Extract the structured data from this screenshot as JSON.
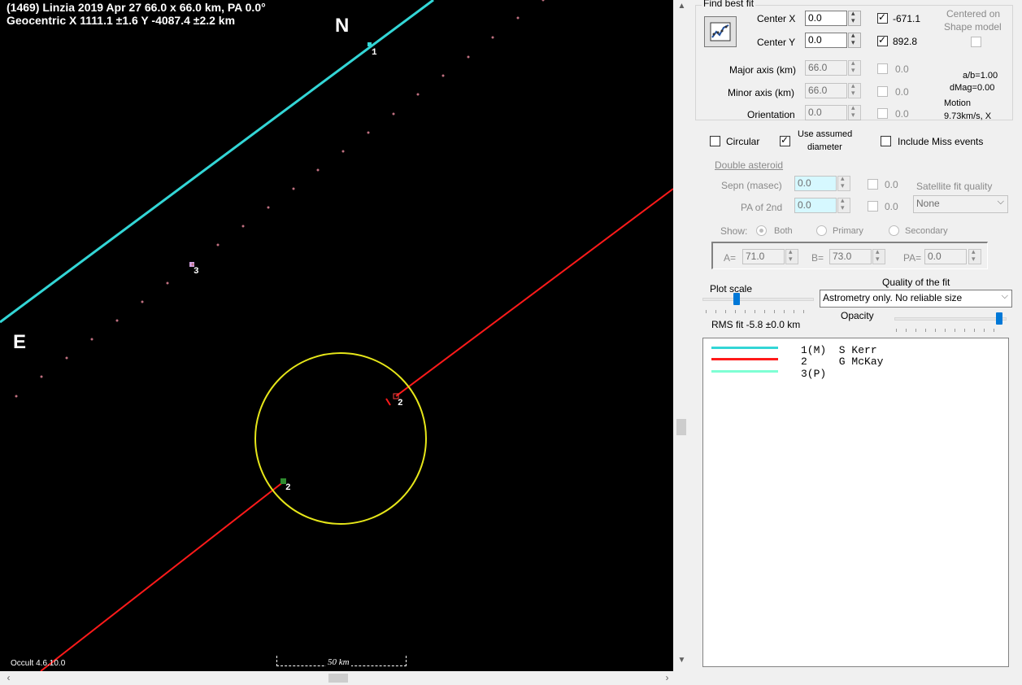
{
  "plot": {
    "title_line1": "(1469) Linzia  2019 Apr 27  66.0 x 66.0 km, PA 0.0°",
    "title_line2": "Geocentric X  1111.1 ±1.6  Y -4087.4 ±2.2 km",
    "north_label": "N",
    "east_label": "E",
    "version": "Occult 4.6.10.0",
    "scale_label": "50 km",
    "chord_labels": [
      "1",
      "3",
      "2",
      "2"
    ],
    "colors": {
      "chord1": "#33d6d6",
      "chord2": "#ff1a1a",
      "limb": "#e6e619",
      "path_dots": "#c07080"
    }
  },
  "panel": {
    "find_best_fit": "Find best fit",
    "center_x_label": "Center X",
    "center_x_value": "0.0",
    "center_x_result": "-671.1",
    "center_y_label": "Center Y",
    "center_y_value": "0.0",
    "center_y_result": "892.8",
    "centered_on": "Centered on",
    "shape_model": "Shape model",
    "major_label": "Major axis (km)",
    "major_value": "66.0",
    "major_result": "0.0",
    "minor_label": "Minor axis (km)",
    "minor_value": "66.0",
    "minor_result": "0.0",
    "orientation_label": "Orientation",
    "orientation_value": "0.0",
    "orientation_result": "0.0",
    "ab_ratio": "a/b=1.00",
    "dmag": "dMag=0.00",
    "motion_label": "Motion",
    "motion_value": "9.73km/s, X",
    "circular": "Circular",
    "use_assumed_1": "Use assumed",
    "use_assumed_2": "diameter",
    "include_miss": "Include Miss events",
    "double_asteroid": "Double asteroid",
    "sepn_label": "Sepn (masec)",
    "sepn_value": "0.0",
    "sepn_result": "0.0",
    "pa2_label": "PA of 2nd",
    "pa2_value": "0.0",
    "pa2_result": "0.0",
    "sat_fit_quality": "Satellite fit quality",
    "sat_fit_value": "None",
    "show_label": "Show:",
    "show_both": "Both",
    "show_primary": "Primary",
    "show_secondary": "Secondary",
    "a_label": "A=",
    "a_value": "71.0",
    "b_label": "B=",
    "b_value": "73.0",
    "pa_label": "PA=",
    "pa_value": "0.0",
    "plot_scale": "Plot scale",
    "quality_label": "Quality of the fit",
    "quality_value": "Astrometry only. No reliable size",
    "opacity": "Opacity",
    "rms_fit": "RMS fit -5.8 ±0.0 km"
  },
  "legend": [
    {
      "text": "1(M)  S Kerr",
      "color": "#33d6d6"
    },
    {
      "text": "2     G McKay",
      "color": "#ff1a1a"
    },
    {
      "text": "3(P)",
      "color": "#7fffd4"
    }
  ]
}
